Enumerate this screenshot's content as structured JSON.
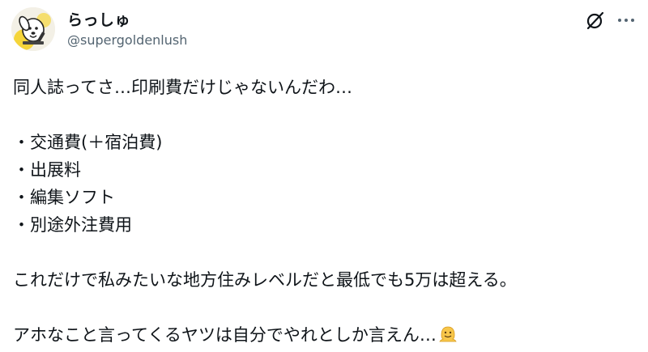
{
  "user": {
    "display_name": "らっしゅ",
    "handle": "@supergoldenlush",
    "avatar_icon": "dog-avatar-icon"
  },
  "header_actions": {
    "grok_icon": "grok-icon",
    "more_icon": "more-icon"
  },
  "tweet": {
    "line1": "同人誌ってさ…印刷費だけじゃないんだわ…",
    "bullets": [
      "・交通費(＋宿泊費)",
      "・出展料",
      "・編集ソフト",
      "・別途外注費用"
    ],
    "line2": "これだけで私みたいな地方住みレベルだと最低でも5万は超える。",
    "line3": "アホなこと言ってくるヤツは自分でやれとしか言えん…",
    "line3_emoji": "melting-face-emoji"
  },
  "colors": {
    "text": "#0f1419",
    "secondary_text": "#536471",
    "background": "#ffffff",
    "avatar_accent": "#f5d53a"
  }
}
